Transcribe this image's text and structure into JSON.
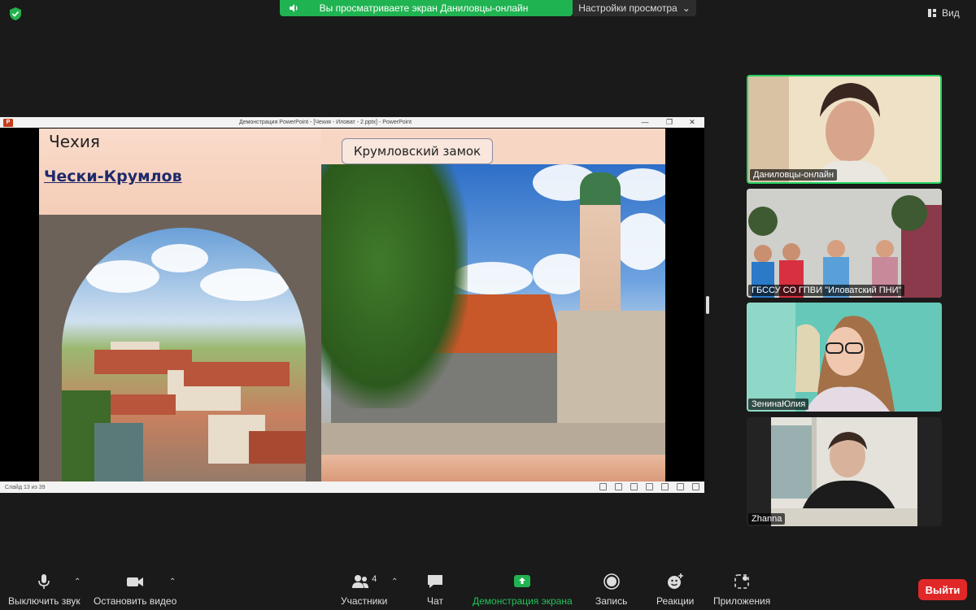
{
  "top_bar": {
    "share_banner": "Вы просматриваете экран Даниловцы-онлайн",
    "view_settings": "Настройки просмотра",
    "view_label": "Вид"
  },
  "ppt": {
    "title": "Демонстрация PowerPoint - [Чехия - Иловат - 2.pptx] - PowerPoint",
    "status": "Слайд 13 из 39",
    "slide": {
      "title": "Чехия",
      "subtitle": "Чески-Крумлов",
      "photo_label": "Крумловский замок"
    }
  },
  "participants": [
    {
      "name": "Даниловцы-онлайн",
      "active": true
    },
    {
      "name": "ГБССУ СО ГПВИ \"Иловатский ПНИ\""
    },
    {
      "name": "ЗенинаЮлия"
    },
    {
      "name": "Zhanna"
    }
  ],
  "toolbar": {
    "mute": "Выключить звук",
    "video": "Остановить видео",
    "participants": "Участники",
    "participants_count": "4",
    "chat": "Чат",
    "share": "Демонстрация экрана",
    "record": "Запись",
    "reactions": "Реакции",
    "apps": "Приложения",
    "leave": "Выйти"
  },
  "colors": {
    "share_green": "#20b351",
    "active_border": "#23d160",
    "leave_red": "#e02828"
  }
}
